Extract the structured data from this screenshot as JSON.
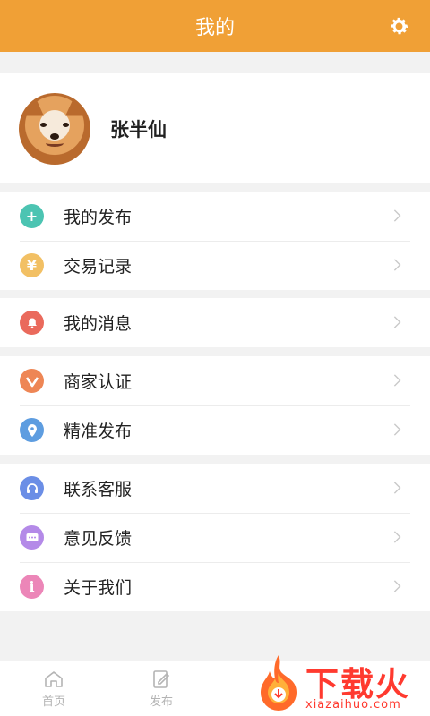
{
  "header": {
    "title": "我的"
  },
  "profile": {
    "name": "张半仙"
  },
  "groups": [
    [
      {
        "label": "我的发布",
        "icon": "plus-icon",
        "color": "#4cc4b2",
        "glyph": "+"
      },
      {
        "label": "交易记录",
        "icon": "yen-icon",
        "color": "#f2c064",
        "glyph": "¥"
      }
    ],
    [
      {
        "label": "我的消息",
        "icon": "bell-icon",
        "color": "#ea6a5c",
        "glyph": ""
      }
    ],
    [
      {
        "label": "商家认证",
        "icon": "v-badge-icon",
        "color": "#ee8655",
        "glyph": "V"
      },
      {
        "label": "精准发布",
        "icon": "location-pin-icon",
        "color": "#5e9de0",
        "glyph": ""
      }
    ],
    [
      {
        "label": "联系客服",
        "icon": "headset-icon",
        "color": "#6b8ee6",
        "glyph": ""
      },
      {
        "label": "意见反馈",
        "icon": "chat-bubble-icon",
        "color": "#b48ae8",
        "glyph": ""
      },
      {
        "label": "关于我们",
        "icon": "info-icon",
        "color": "#ec86b8",
        "glyph": "i"
      }
    ]
  ],
  "tabbar": {
    "tabs": [
      {
        "label": "首页"
      },
      {
        "label": "发布"
      }
    ]
  },
  "watermark": {
    "text": "下载火",
    "url": "xiazaihuo.com"
  }
}
